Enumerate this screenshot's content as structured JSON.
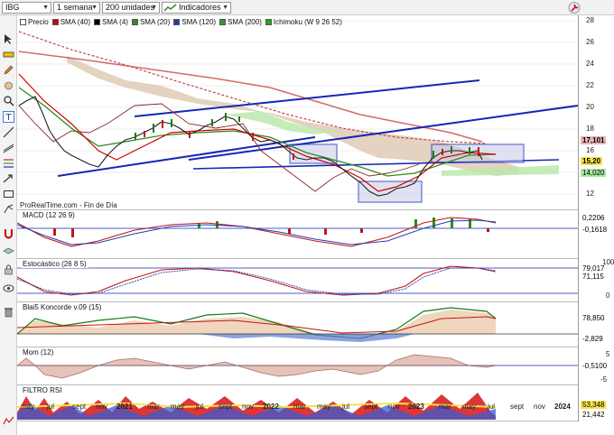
{
  "toolbar": {
    "symbol": "IBG",
    "timeframe": "1 semana",
    "units": "200 unidades",
    "indicators_label": "Indicadores"
  },
  "price_pane": {
    "legend": [
      {
        "label": "Precio",
        "color": "#ffffff"
      },
      {
        "label": "SMA (40)",
        "color": "#d00000"
      },
      {
        "label": "SMA (4)",
        "color": "#000000"
      },
      {
        "label": "SMA (20)",
        "color": "#3a8a1e"
      },
      {
        "label": "SMA (120)",
        "color": "#1d3fb2"
      },
      {
        "label": "SMA (200)",
        "color": "#2e9b2e"
      },
      {
        "label": "Ichimoku (W 9 26 52)",
        "color": "#22aa22"
      }
    ],
    "watermark": "ProRealTime.com - Fin de Día",
    "axis_ticks": [
      "28",
      "26",
      "24",
      "22",
      "20",
      "18",
      "16",
      "14",
      "12"
    ],
    "tags": [
      {
        "text": "17,101",
        "color": "#e8b4b4"
      },
      {
        "text": "15,20",
        "color": "#f7e24b"
      },
      {
        "text": "14,020",
        "color": "#a8e6a0"
      }
    ]
  },
  "macd_pane": {
    "title": "MACD (12 26 9)",
    "tags": [
      {
        "text": "0,2206",
        "color": "#ffffff"
      },
      {
        "text": "-0,1618",
        "color": "#ffffff"
      }
    ]
  },
  "stoch_pane": {
    "title": "Estocástico (26 8 5)",
    "ticks": [
      "100",
      "0"
    ],
    "tags": [
      {
        "text": "79,017",
        "color": "#ffffff"
      },
      {
        "text": "71,115",
        "color": "#ffffff"
      }
    ]
  },
  "koncorde_pane": {
    "title": "Blai5 Koncorde v.09 (15)",
    "tags": [
      {
        "text": "78,850",
        "color": "#ffffff"
      },
      {
        "text": "-2,829",
        "color": "#ffffff"
      }
    ]
  },
  "mom_pane": {
    "title": "Mom (12)",
    "ticks": [
      "5",
      "0",
      "-5"
    ],
    "tags": [
      {
        "text": "-0,5100",
        "color": "#ffffff"
      }
    ]
  },
  "filtro_pane": {
    "title": "FILTRO RSI",
    "tags": [
      {
        "text": "53,348",
        "color": "#f7e24b"
      },
      {
        "text": "21,442",
        "color": "#ffffff"
      }
    ]
  },
  "date_axis": [
    "may",
    "jul",
    "sept",
    "nov",
    "2021",
    "mar",
    "may",
    "jul",
    "sept",
    "nov",
    "2022",
    "mar",
    "may",
    "jul",
    "sept",
    "nov",
    "2023",
    "mar",
    "may",
    "jul",
    "sept",
    "nov",
    "2024"
  ],
  "colors": {
    "trendline": "#1428b4",
    "box_fill": "#c7cbe8",
    "cloud_fill": "#dcc8b0",
    "sma200": "#c84646",
    "green_ma": "#2e8b1e"
  }
}
